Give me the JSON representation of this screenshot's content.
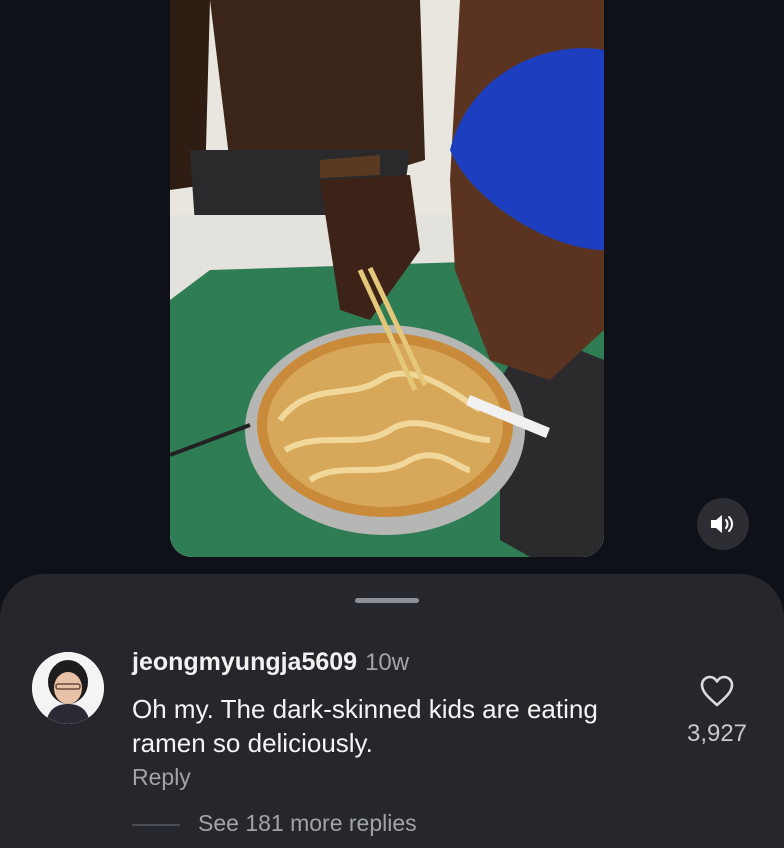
{
  "video": {
    "mute_icon": "speaker-volume-icon"
  },
  "comment": {
    "avatar_icon": "user-avatar",
    "username": "jeongmyungja5609",
    "time": "10w",
    "text": "Oh my. The dark-skinned kids are eating ramen so deliciously.",
    "reply_label": "Reply",
    "like_icon": "heart-outline-icon",
    "like_count": "3,927"
  },
  "replies": {
    "more_label": "See 181 more replies"
  },
  "colors": {
    "background": "#0e1117",
    "sheet": "#25272c",
    "secondary_text": "#a0a3a8"
  }
}
